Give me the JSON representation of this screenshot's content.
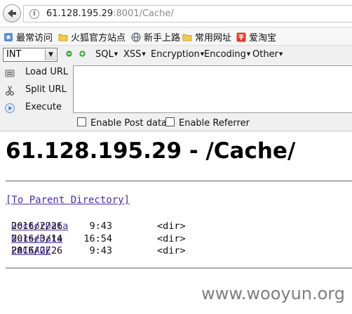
{
  "address_bar": {
    "url_host": "61.128.195.29",
    "url_rest": ":8001/Cache/"
  },
  "bookmarks": [
    {
      "label": "最常访问",
      "icon": "bookmark-star-icon"
    },
    {
      "label": "火狐官方站点",
      "icon": "folder-icon"
    },
    {
      "label": "新手上路",
      "icon": "globe-icon"
    },
    {
      "label": "常用网址",
      "icon": "folder-icon"
    },
    {
      "label": "爱淘宝",
      "icon": "taobao-icon"
    }
  ],
  "hackbar": {
    "select_value": "INT",
    "menus": [
      "SQL",
      "XSS",
      "Encryption",
      "Encoding",
      "Other"
    ],
    "actions": [
      "Load URL",
      "Split URL",
      "Execute"
    ],
    "checkboxes": [
      "Enable Post data",
      "Enable Referrer"
    ],
    "colors": {
      "minus": "#2e9e2e",
      "plus": "#2e9e2e"
    }
  },
  "page": {
    "heading": "61.128.195.29 - /Cache/",
    "parent_link": "[To Parent Directory]",
    "entries": [
      {
        "date": "2016/2/26",
        "time": "9:43",
        "type": "<dir>",
        "name": "DoctorData"
      },
      {
        "date": "2016/3/14",
        "time": "16:54",
        "type": "<dir>",
        "name": "NurseData"
      },
      {
        "date": "2016/2/26",
        "time": "9:43",
        "type": "<dir>",
        "name": "PACKAGE"
      }
    ]
  },
  "watermark": "www.wooyun.org"
}
